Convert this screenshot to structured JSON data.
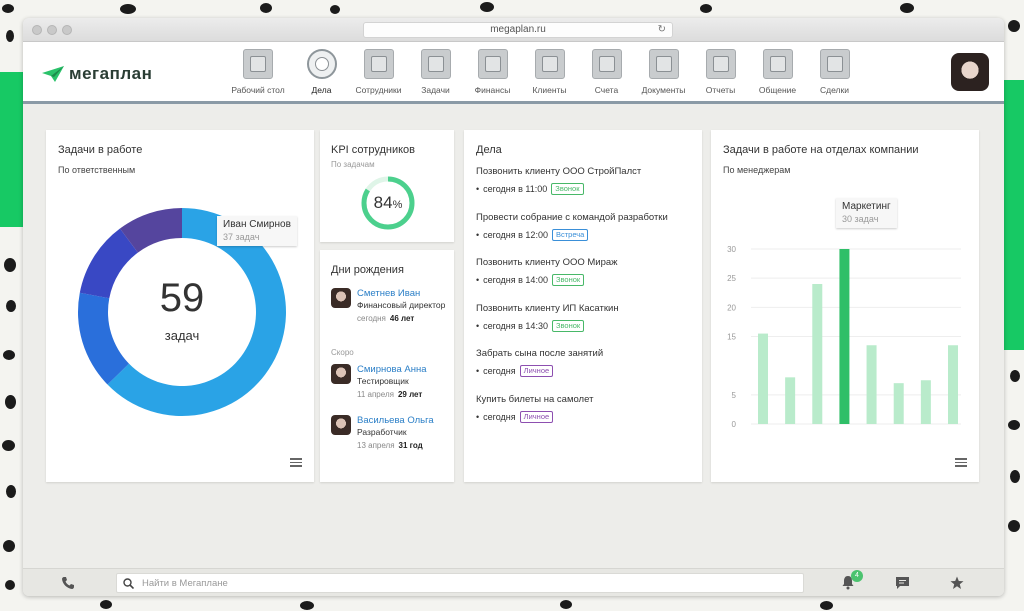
{
  "browser": {
    "url": "megaplan.ru"
  },
  "app": {
    "logo_text": "мегаплан"
  },
  "nav": [
    {
      "label": "Рабочий стол",
      "icon": "dashboard-icon"
    },
    {
      "label": "Дела",
      "icon": "clock-icon",
      "active": true
    },
    {
      "label": "Сотрудники",
      "icon": "people-icon"
    },
    {
      "label": "Задачи",
      "icon": "clipboard-icon"
    },
    {
      "label": "Финансы",
      "icon": "safe-icon"
    },
    {
      "label": "Клиенты",
      "icon": "address-book-icon"
    },
    {
      "label": "Счета",
      "icon": "invoice-icon"
    },
    {
      "label": "Документы",
      "icon": "folder-icon"
    },
    {
      "label": "Отчеты",
      "icon": "chart-icon"
    },
    {
      "label": "Общение",
      "icon": "chat-icon"
    },
    {
      "label": "Сделки",
      "icon": "briefcase-icon"
    }
  ],
  "tasks_card": {
    "title": "Задачи в работе",
    "subtitle": "По ответственным",
    "total": "59",
    "total_label": "задач",
    "tooltip_name": "Иван Смирнов",
    "tooltip_value": "37 задач",
    "donut": {
      "segments": [
        {
          "value": 37,
          "color": "#2aa3e6"
        },
        {
          "value": 9,
          "color": "#2a6fdb"
        },
        {
          "value": 7,
          "color": "#3948c4"
        },
        {
          "value": 6,
          "color": "#55459e"
        }
      ]
    }
  },
  "kpi_card": {
    "title": "KPI сотрудников",
    "subtitle": "По задачам",
    "value": "84",
    "unit": "%",
    "progress": 0.84,
    "color": "#4cd08d"
  },
  "birthdays_card": {
    "title": "Дни рождения",
    "soon_label": "Скоро",
    "people": [
      {
        "name": "Сметнев Иван",
        "role": "Финансовый директор",
        "date": "сегодня",
        "age": "46 лет"
      },
      {
        "name": "Смирнова Анна",
        "role": "Тестировщик",
        "date": "11 апреля",
        "age": "29 лет"
      },
      {
        "name": "Васильева Ольга",
        "role": "Разработчик",
        "date": "13 апреля",
        "age": "31 год"
      }
    ]
  },
  "deals_card": {
    "title": "Дела",
    "items": [
      {
        "title": "Позвонить клиенту ООО СтройПалст",
        "when": "сегодня в 11:00",
        "badge": "Звонок",
        "badge_color": "#48b868"
      },
      {
        "title": "Провести собрание с командой разработки",
        "when": "сегодня в 12:00",
        "badge": "Встреча",
        "badge_color": "#3a8fd8"
      },
      {
        "title": "Позвонить клиенту ООО Мираж",
        "when": "сегодня в 14:00",
        "badge": "Звонок",
        "badge_color": "#48b868"
      },
      {
        "title": "Позвонить клиенту ИП Касаткин",
        "when": "сегодня в 14:30",
        "badge": "Звонок",
        "badge_color": "#48b868"
      },
      {
        "title": "Забрать сына после занятий",
        "when": "сегодня",
        "badge": "Личное",
        "badge_color": "#8d4fb0"
      },
      {
        "title": "Купить билеты на самолет",
        "when": "сегодня",
        "badge": "Личное",
        "badge_color": "#8d4fb0"
      }
    ]
  },
  "dept_card": {
    "title": "Задачи в работе на отделах компании",
    "subtitle": "По менеджерам",
    "tooltip_name": "Маркетинг",
    "tooltip_value": "30 задач"
  },
  "chart_data": {
    "type": "bar",
    "title": "Задачи в работе на отделах компании",
    "ylim": [
      0,
      30
    ],
    "yticks": [
      0,
      5,
      15,
      20,
      25,
      30
    ],
    "values": [
      15.5,
      8,
      24,
      30,
      13.5,
      7,
      7.5,
      13.5
    ],
    "highlight_index": 3,
    "color": "#b9ebcb",
    "highlight_color": "#2fbf68"
  },
  "bottombar": {
    "search_placeholder": "Найти в Мегаплане",
    "notifications_count": "4"
  }
}
